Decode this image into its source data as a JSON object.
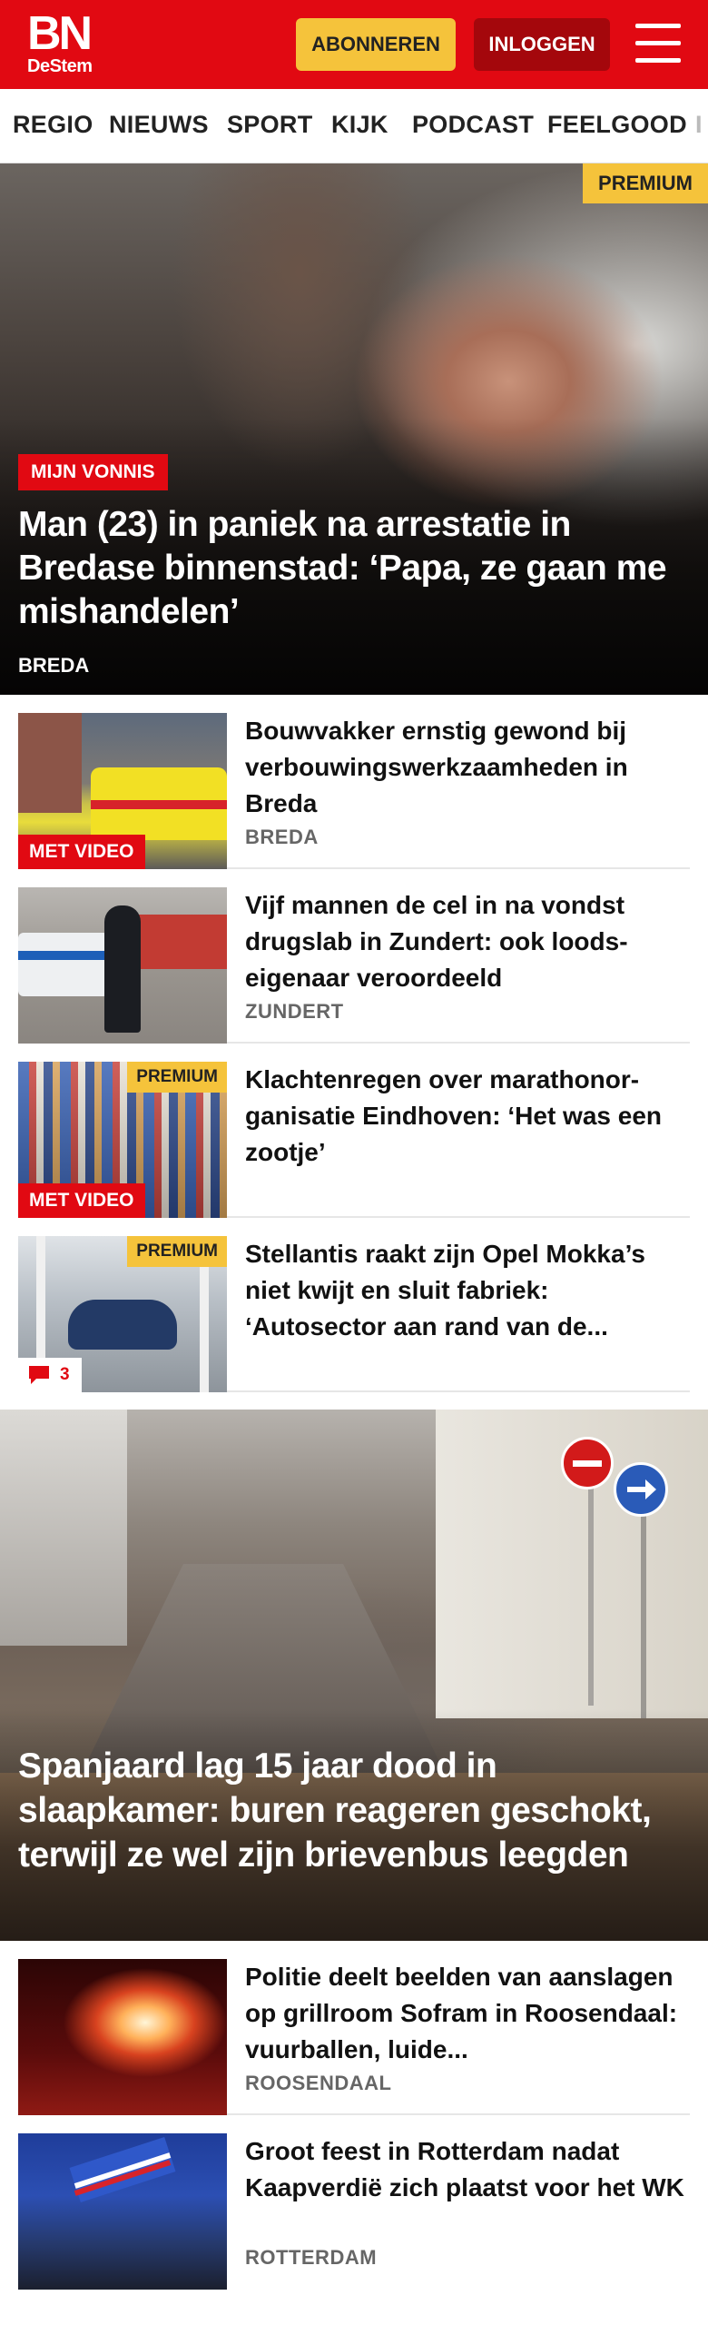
{
  "header": {
    "logo_main": "BN",
    "logo_sub": "DeStem",
    "subscribe_label": "ABONNEREN",
    "login_label": "INLOGGEN",
    "brand_color": "#e10912",
    "accent_color": "#f5c33b"
  },
  "nav": {
    "items": [
      {
        "label": "REGIO"
      },
      {
        "label": "NIEUWS"
      },
      {
        "label": "SPORT"
      },
      {
        "label": "KIJK"
      },
      {
        "label": "PODCAST"
      },
      {
        "label": "FEELGOOD"
      },
      {
        "label": "I"
      }
    ]
  },
  "hero": {
    "badge": "PREMIUM",
    "label": "MIJN VONNIS",
    "title": "Man (23) in paniek na arrestatie in Bredase binnenstad: ‘Papa, ze gaan me mishandelen’",
    "location": "BREDA"
  },
  "articles": [
    {
      "title": "Bouwvakker ernstig gewond bij verbouwingswerkzaamheden in Breda",
      "location": "BREDA",
      "video": "MET VIDEO"
    },
    {
      "title": "Vijf mannen de cel in na vondst drugslab in Zundert: ook loods-eigenaar veroordeeld",
      "location": "ZUNDERT"
    },
    {
      "title": "Klachtenregen over marathonor-ganisatie Eindhoven: ‘Het was een zootje’",
      "premium": "PREMIUM",
      "video": "MET VIDEO"
    },
    {
      "title": "Stellantis raakt zijn Opel Mokka’s niet kwijt en sluit fabriek: ‘Autosector aan rand van de...",
      "premium": "PREMIUM",
      "comments": "3"
    }
  ],
  "hero2": {
    "title": "Spanjaard lag 15 jaar dood in slaapkamer: buren reageren geschokt, terwijl ze wel zijn brievenbus leegden"
  },
  "articles2": [
    {
      "title": "Politie deelt beelden van aanslagen op grillroom Sofram in Roosendaal: vuurballen, luide...",
      "location": "ROOSENDAAL"
    },
    {
      "title": "Groot feest in Rotterdam nadat Kaapverdië zich plaatst voor het WK",
      "location": "ROTTERDAM"
    }
  ]
}
